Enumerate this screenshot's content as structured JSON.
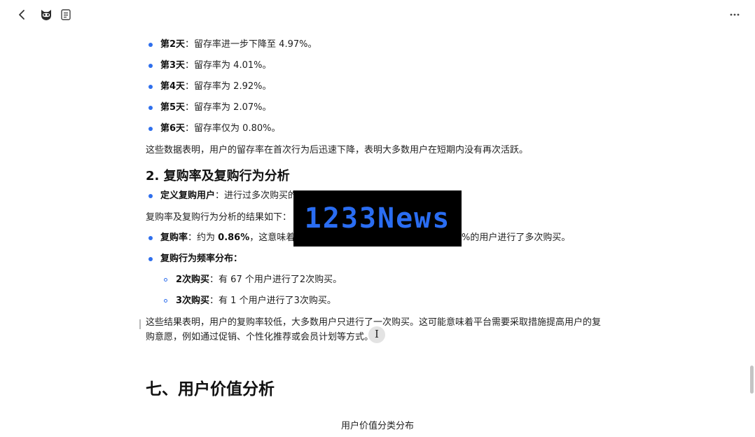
{
  "toolbar": {
    "back_icon": "chevron-left-icon",
    "avatar_icon": "raccoon-avatar-icon",
    "doc_icon": "document-icon",
    "more_icon": "more-horizontal-icon"
  },
  "retention": {
    "items": [
      {
        "label": "第2天",
        "text": "：留存率进一步下降至 4.97%。"
      },
      {
        "label": "第3天",
        "text": "：留存率为 4.01%。"
      },
      {
        "label": "第4天",
        "text": "：留存率为 2.92%。"
      },
      {
        "label": "第5天",
        "text": "：留存率为 2.07%。"
      },
      {
        "label": "第6天",
        "text": "：留存率仅为 0.80%。"
      }
    ],
    "summary": "这些数据表明，用户的留存率在首次行为后迅速下降，表明大多数用户在短期内没有再次活跃。"
  },
  "repurchase": {
    "heading": "2. 复购率及复购行为分析",
    "definition_label": "定义复购用户",
    "definition_text": "：进行过多次购买的",
    "intro": "复购率及复购行为分析的结果如下：",
    "rate_label": "复购率",
    "rate_text_a": "：约为 ",
    "rate_value": "0.86%",
    "rate_text_b": "，这意味着",
    "rate_text_c": "%的用户进行了多次购买。",
    "freq_label": "复购行为频率分布",
    "freq_colon": "：",
    "freq_items": [
      {
        "label": "2次购买",
        "text": "：有 67 个用户进行了2次购买。"
      },
      {
        "label": "3次购买",
        "text": "：有 1 个用户进行了3次购买。"
      }
    ],
    "conclusion_line1": "这些结果表明，用户的复购率较低，大多数用户只进行了一次购买。这可能意味着平台需要采取措施提高用户的复",
    "conclusion_line2": "购意愿，例如通过促销、个性化推荐或会员计划等方式。"
  },
  "section7": {
    "heading": "七、用户价值分析",
    "chart_title": "用户价值分类分布"
  },
  "watermark": {
    "text": "1233News"
  },
  "cursor": {
    "glyph": "I"
  },
  "colors": {
    "bullet": "#2f6fed",
    "watermark_bg": "#000000",
    "watermark_fg": "#2a6df2"
  }
}
